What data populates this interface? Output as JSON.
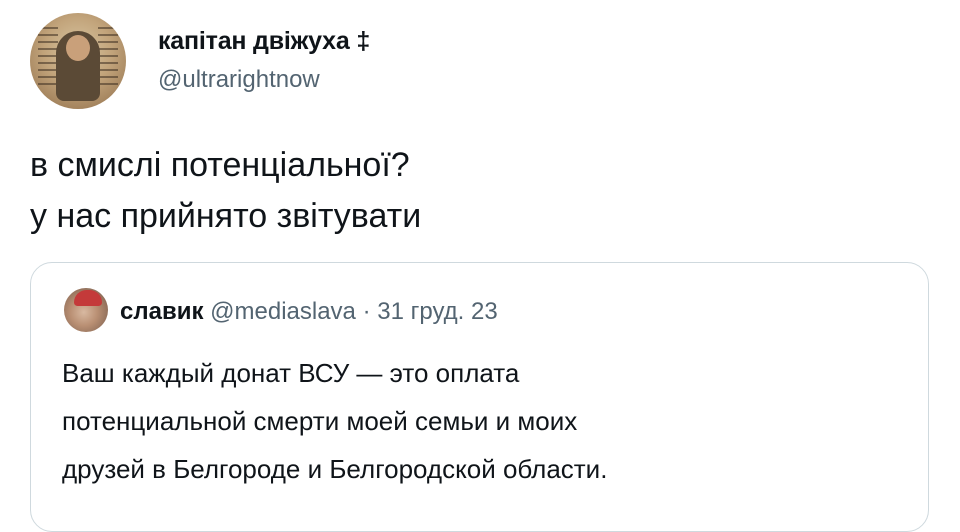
{
  "author": {
    "display_name": "капітан двіжуха ‡",
    "handle": "@ultrarightnow",
    "avatar_icon": "portrait-avatar"
  },
  "tweet": {
    "line1": "в смислі потенціальної?",
    "line2": "у нас прийнято звітувати"
  },
  "quoted": {
    "author_name": "славик",
    "handle": "@mediaslava",
    "separator": "·",
    "date": "31 груд. 23",
    "line1": "Ваш каждый донат ВСУ — это оплата",
    "line2": "потенциальной смерти моей семьи и моих",
    "line3": "друзей в Белгороде и Белгородской области.",
    "avatar_icon": "user-avatar"
  },
  "colors": {
    "text": "#0f1419",
    "secondary": "#536471",
    "border": "#cfd9de"
  }
}
